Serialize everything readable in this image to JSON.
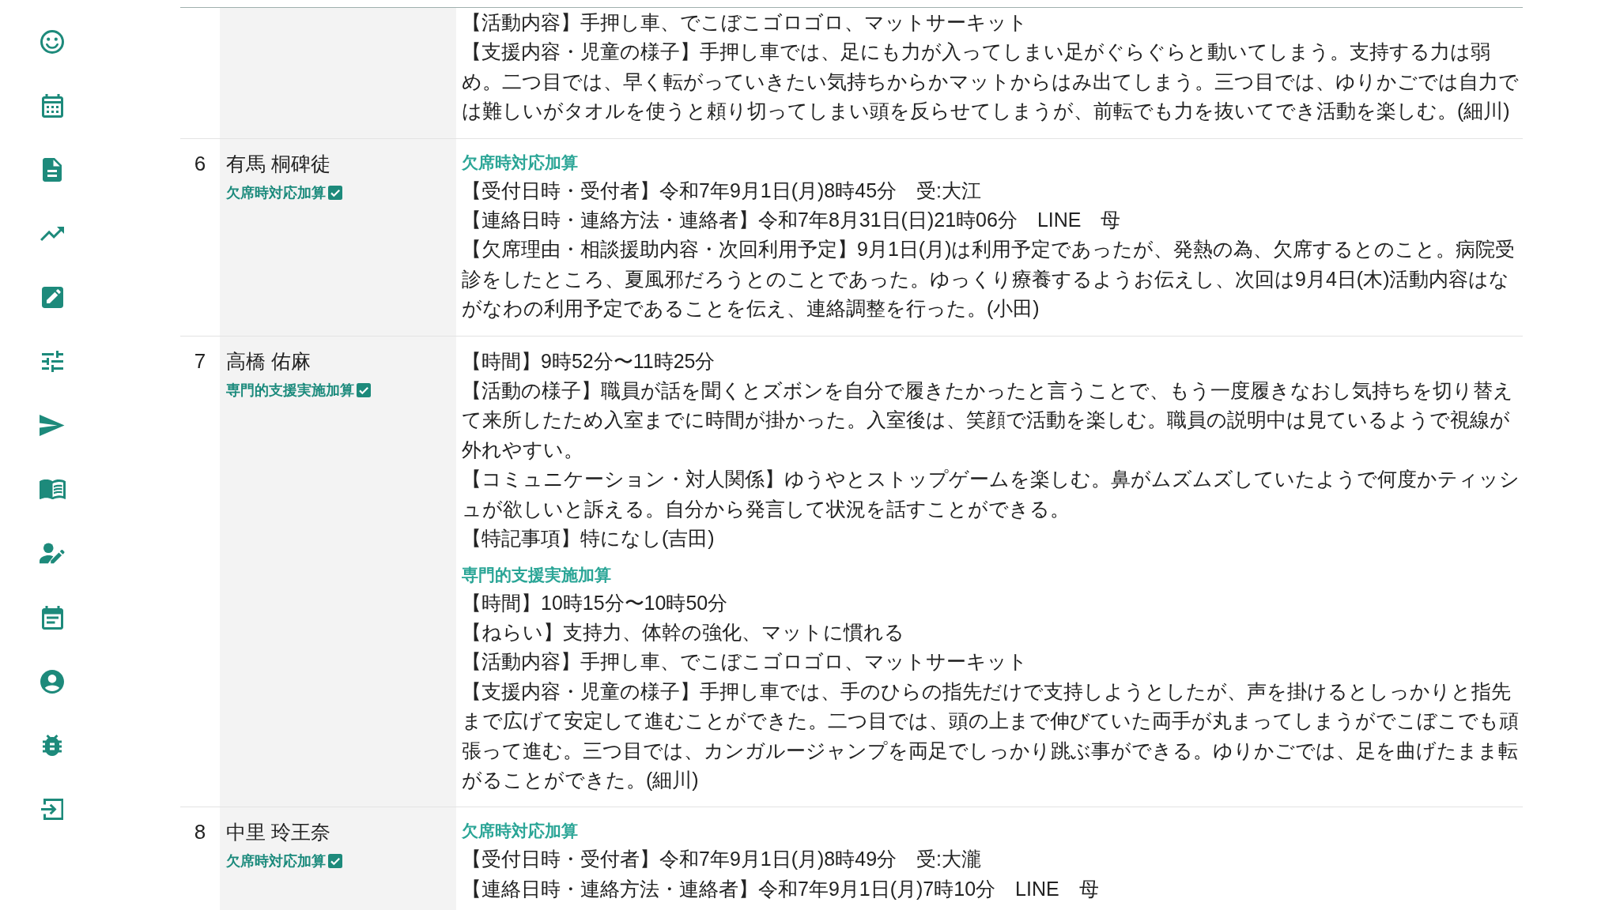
{
  "table": {
    "rows": [
      {
        "sections": [
          {
            "paragraphs": [
              "【活動内容】手押し車、でこぼこゴロゴロ、マットサーキット",
              "【支援内容・児童の様子】手押し車では、足にも力が入ってしまい足がぐらぐらと動いてしまう。支持する力は弱め。二つ目では、早く転がっていきたい気持ちからかマットからはみ出てしまう。三つ目では、ゆりかごでは自力では難しいがタオルを使うと頼り切ってしまい頭を反らせてしまうが、前転でも力を抜いてでき活動を楽しむ。(細川)"
            ]
          }
        ]
      },
      {
        "number": "6",
        "name": "有馬 桐碑徒",
        "badges": [
          {
            "label": "欠席時対応加算",
            "checked": true
          }
        ],
        "sections": [
          {
            "title": "欠席時対応加算",
            "paragraphs": [
              "【受付日時・受付者】令和7年9月1日(月)8時45分　受:大江",
              "【連絡日時・連絡方法・連絡者】令和7年8月31日(日)21時06分　LINE　母",
              "【欠席理由・相談援助内容・次回利用予定】9月1日(月)は利用予定であったが、発熱の為、欠席するとのこと。病院受診をしたところ、夏風邪だろうとのことであった。ゆっくり療養するようお伝えし、次回は9月4日(木)活動内容はながなわの利用予定であることを伝え、連絡調整を行った。(小田)"
            ]
          }
        ]
      },
      {
        "number": "7",
        "name": "高橋 佑麻",
        "badges": [
          {
            "label": "専門的支援実施加算",
            "checked": true
          }
        ],
        "sections": [
          {
            "paragraphs": [
              "【時間】9時52分〜11時25分",
              "【活動の様子】職員が話を聞くとズボンを自分で履きたかったと言うことで、もう一度履きなおし気持ちを切り替えて来所したため入室までに時間が掛かった。入室後は、笑顔で活動を楽しむ。職員の説明中は見ているようで視線が外れやすい。",
              "【コミュニケーション・対人関係】ゆうやとストップゲームを楽しむ。鼻がムズムズしていたようで何度かティッシュが欲しいと訴える。自分から発言して状況を話すことができる。",
              "【特記事項】特になし(吉田)"
            ]
          },
          {
            "title": "専門的支援実施加算",
            "paragraphs": [
              "【時間】10時15分〜10時50分",
              "【ねらい】支持力、体幹の強化、マットに慣れる",
              "【活動内容】手押し車、でこぼこゴロゴロ、マットサーキット",
              "【支援内容・児童の様子】手押し車では、手のひらの指先だけで支持しようとしたが、声を掛けるとしっかりと指先まで広げて安定して進むことができた。二つ目では、頭の上まで伸びていた両手が丸まってしまうがでこぼこでも頑張って進む。三つ目では、カンガルージャンプを両足でしっかり跳ぶ事ができる。ゆりかごでは、足を曲げたまま転がることができた。(細川)"
            ]
          }
        ]
      },
      {
        "number": "8",
        "name": "中里 玲王奈",
        "badges": [
          {
            "label": "欠席時対応加算",
            "checked": true
          }
        ],
        "sections": [
          {
            "title": "欠席時対応加算",
            "paragraphs": [
              "【受付日時・受付者】令和7年9月1日(月)8時49分　受:大瀧",
              "【連絡日時・連絡方法・連絡者】令和7年9月1日(月)7時10分　LINE　母"
            ]
          }
        ]
      }
    ]
  }
}
